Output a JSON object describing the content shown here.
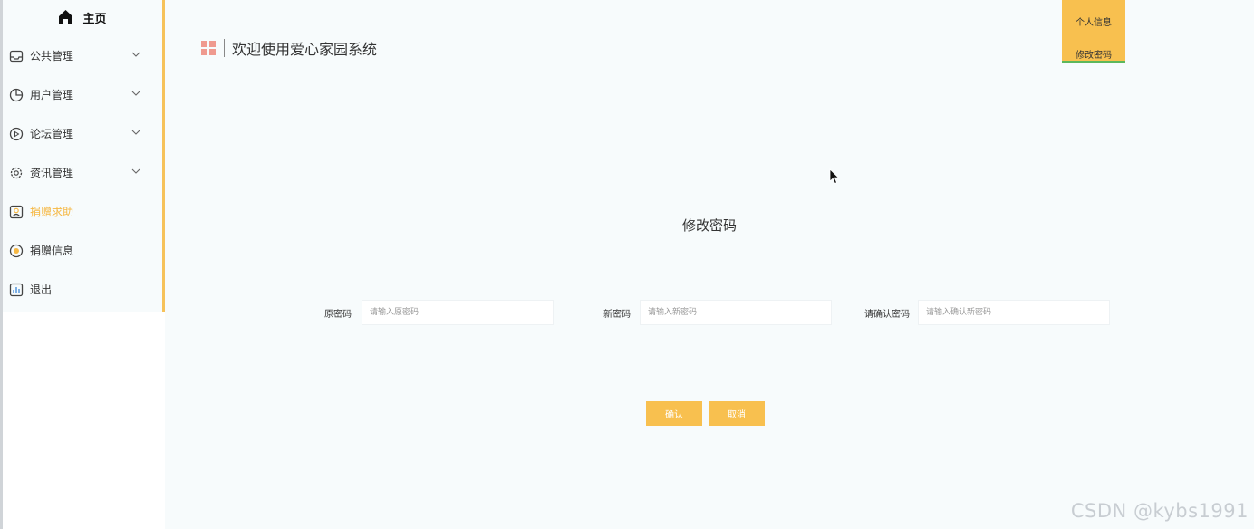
{
  "sidebar": {
    "home_label": "主页",
    "items": [
      {
        "label": "公共管理",
        "icon": "inbox-icon",
        "has_submenu": true
      },
      {
        "label": "用户管理",
        "icon": "pie-chart-icon",
        "has_submenu": true
      },
      {
        "label": "论坛管理",
        "icon": "play-circle-icon",
        "has_submenu": true
      },
      {
        "label": "资讯管理",
        "icon": "gear-icon",
        "has_submenu": true
      },
      {
        "label": "捐赠求助",
        "icon": "user-card-icon",
        "has_submenu": false,
        "active": true
      },
      {
        "label": "捐赠信息",
        "icon": "record-icon",
        "has_submenu": false
      },
      {
        "label": "退出",
        "icon": "bar-chart-icon",
        "has_submenu": false
      }
    ]
  },
  "header": {
    "welcome": "欢迎使用爱心家园系统"
  },
  "user_menu": {
    "items": [
      "个人信息",
      "修改密码"
    ]
  },
  "form": {
    "title": "修改密码",
    "fields": [
      {
        "label": "原密码",
        "placeholder": "请输入原密码",
        "value": ""
      },
      {
        "label": "新密码",
        "placeholder": "请输入新密码",
        "value": ""
      },
      {
        "label": "请确认密码",
        "placeholder": "请输入确认新密码",
        "value": ""
      }
    ],
    "confirm_label": "确认",
    "cancel_label": "取消"
  },
  "watermark": "CSDN @kybs1991",
  "colors": {
    "accent": "#f8c04f",
    "active_text": "#f6b844",
    "menu_underline": "#5cb85c",
    "logo_tiles": "#ef9a8f"
  }
}
